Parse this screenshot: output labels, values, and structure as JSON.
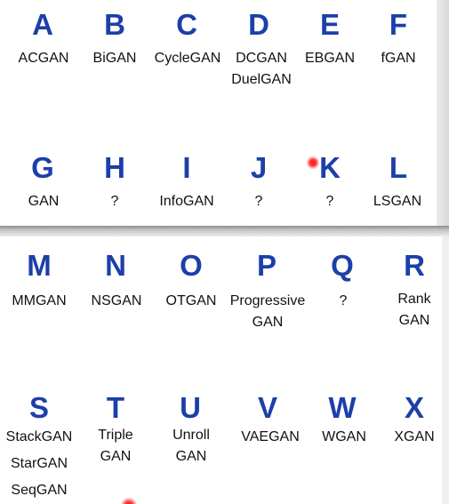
{
  "top": {
    "row1": [
      {
        "letter": "A",
        "names": [
          "ACGAN"
        ]
      },
      {
        "letter": "B",
        "names": [
          "BiGAN"
        ]
      },
      {
        "letter": "C",
        "names": [
          "CycleGAN"
        ]
      },
      {
        "letter": "D",
        "names": [
          "DCGAN",
          "DuelGAN"
        ]
      },
      {
        "letter": "E",
        "names": [
          "EBGAN"
        ]
      },
      {
        "letter": "F",
        "names": [
          "fGAN"
        ]
      }
    ],
    "row2": [
      {
        "letter": "G",
        "names": [
          "GAN"
        ]
      },
      {
        "letter": "H",
        "names": [
          "?"
        ]
      },
      {
        "letter": "I",
        "names": [
          "InfoGAN"
        ]
      },
      {
        "letter": "J",
        "names": [
          "?"
        ]
      },
      {
        "letter": "K",
        "names": [
          "?"
        ]
      },
      {
        "letter": "L",
        "names": [
          "LSGAN"
        ]
      }
    ]
  },
  "bottom": {
    "row1": [
      {
        "letter": "M",
        "names": [
          "MMGAN"
        ]
      },
      {
        "letter": "N",
        "names": [
          "NSGAN"
        ]
      },
      {
        "letter": "O",
        "names": [
          "OTGAN"
        ]
      },
      {
        "letter": "P",
        "names": [
          "Progressive",
          "GAN"
        ]
      },
      {
        "letter": "Q",
        "names": [
          "?"
        ]
      },
      {
        "letter": "R",
        "names": [
          "Rank",
          "GAN"
        ]
      }
    ],
    "row2": [
      {
        "letter": "S",
        "names": [
          "StackGAN",
          "StarGAN",
          "SeqGAN"
        ]
      },
      {
        "letter": "T",
        "names": [
          "Triple",
          "GAN"
        ]
      },
      {
        "letter": "U",
        "names": [
          "Unroll",
          "GAN"
        ]
      },
      {
        "letter": "V",
        "names": [
          "VAEGAN"
        ]
      },
      {
        "letter": "W",
        "names": [
          "WGAN"
        ]
      },
      {
        "letter": "X",
        "names": [
          "XGAN"
        ]
      }
    ]
  },
  "colors": {
    "letter": "#1c3fa8",
    "name": "#111111",
    "laser": "#ff2020"
  }
}
